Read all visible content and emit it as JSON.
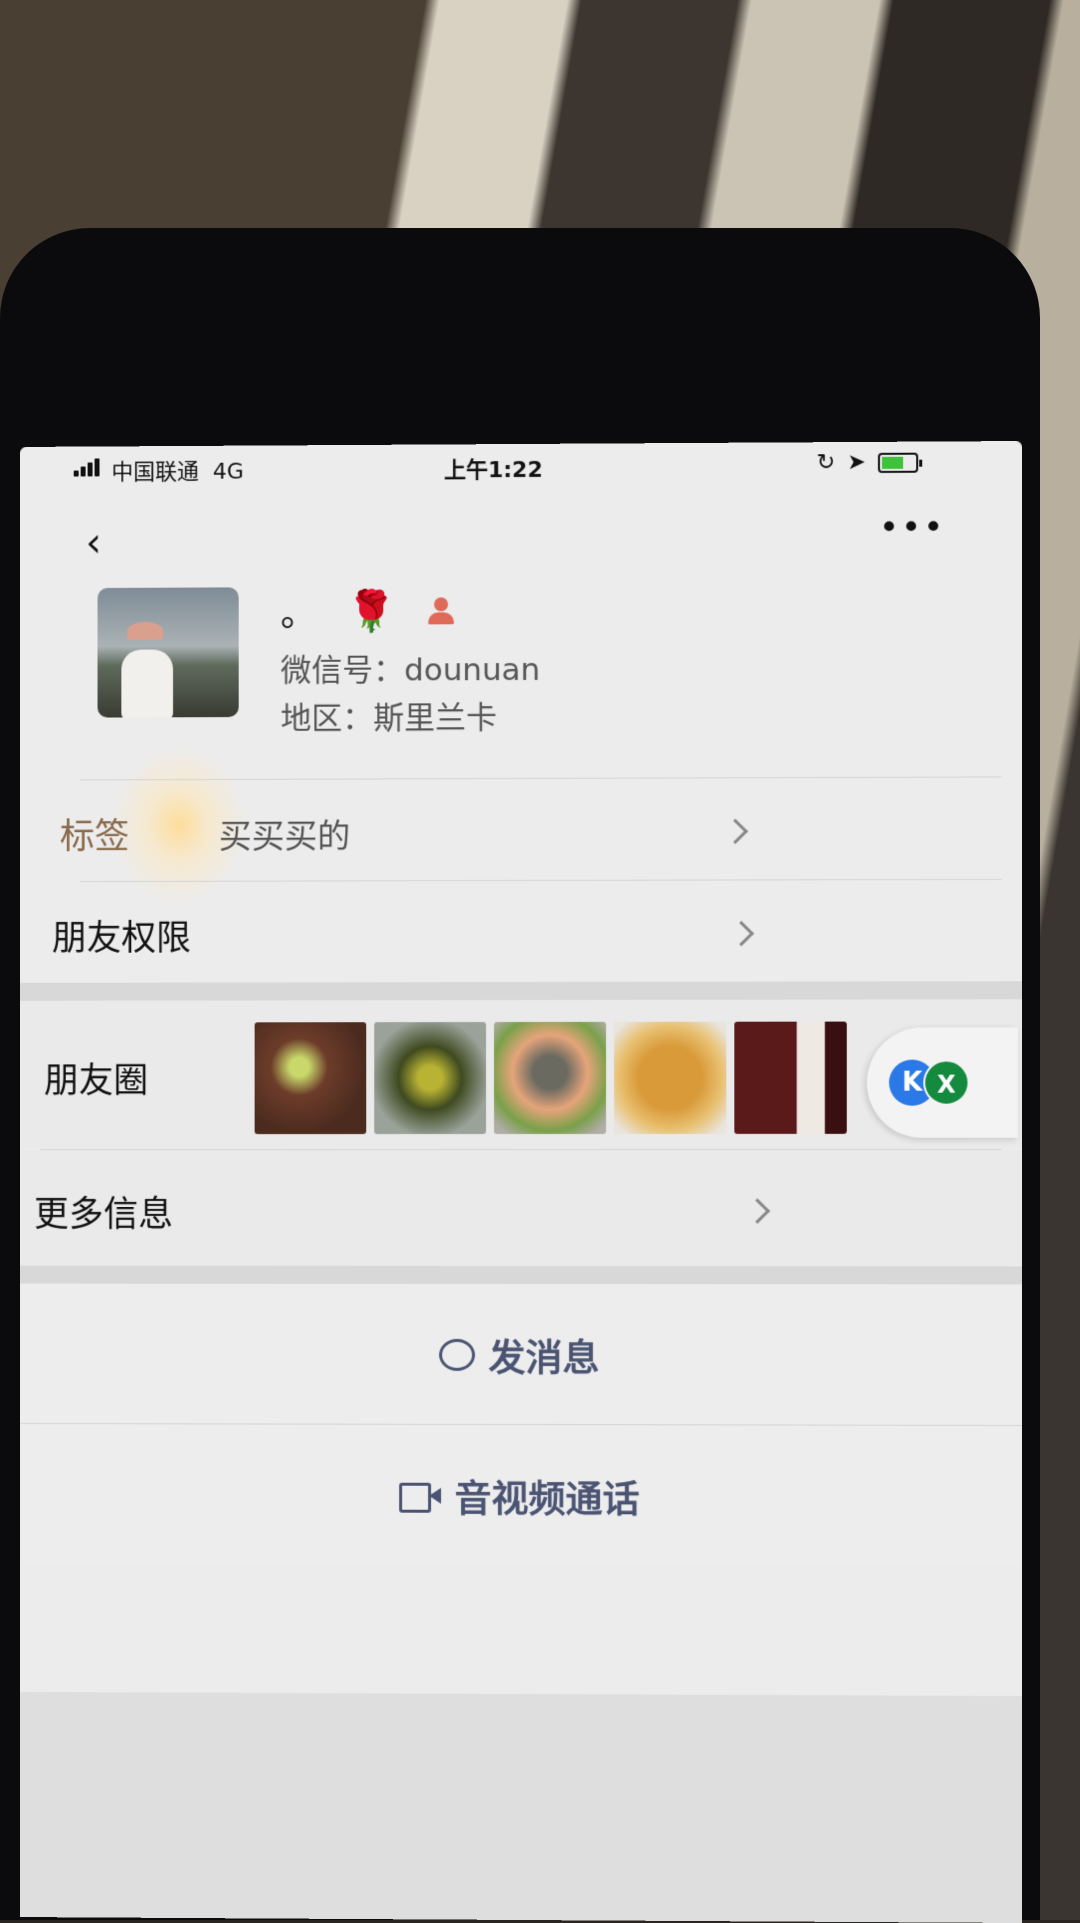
{
  "status_bar": {
    "carrier": "中国联通",
    "network": "4G",
    "time": "上午1:22"
  },
  "nav": {
    "back_icon": "chevron-left-icon",
    "more": "•••"
  },
  "profile": {
    "nickname": "。",
    "rose_emoji": "🌹",
    "wechat_id": "微信号：dounuan",
    "region": "地区：斯里兰卡"
  },
  "rows": {
    "tag_label": "标签",
    "tag_value": "买买买的",
    "permissions_label": "朋友权限",
    "moments_label": "朋友圈",
    "more_info_label": "更多信息"
  },
  "floating": {
    "k_label": "K",
    "x_label": "X"
  },
  "actions": {
    "message": "发消息",
    "call": "音视频通话"
  },
  "colors": {
    "background": "#ececed",
    "tag_accent": "#8a6a4a",
    "action_text": "#4a5372",
    "rose": "#c01a1a"
  }
}
